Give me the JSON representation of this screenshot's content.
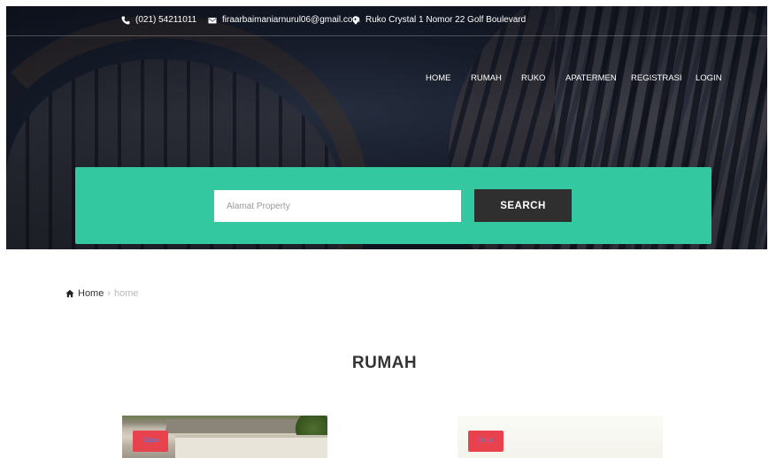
{
  "topbar": {
    "phone": "(021) 54211011",
    "email": "firaarbaimaniarnurul06@gmail.com",
    "address": "Ruko Crystal 1 Nomor 22 Golf Boulevard"
  },
  "nav": {
    "items": [
      {
        "label": "HOME"
      },
      {
        "label": "RUMAH"
      },
      {
        "label": "RUKO"
      },
      {
        "label": "APATERMEN"
      },
      {
        "label": "REGISTRASI"
      },
      {
        "label": "LOGIN"
      }
    ]
  },
  "search": {
    "placeholder": "Alamat Property",
    "button_label": "SEARCH"
  },
  "breadcrumb": {
    "home": "Home",
    "separator": "›",
    "current": "home"
  },
  "section": {
    "title": "RUMAH"
  },
  "listings": [
    {
      "badge": "Dijual"
    },
    {
      "badge": "Dijual"
    }
  ],
  "colors": {
    "accent": "#33c8a0",
    "button": "#2f2f2f",
    "badge": "#e8424f"
  },
  "icons": {
    "phone": "phone-icon",
    "email": "envelope-icon",
    "address": "map-marker-icon",
    "home": "home-icon"
  }
}
